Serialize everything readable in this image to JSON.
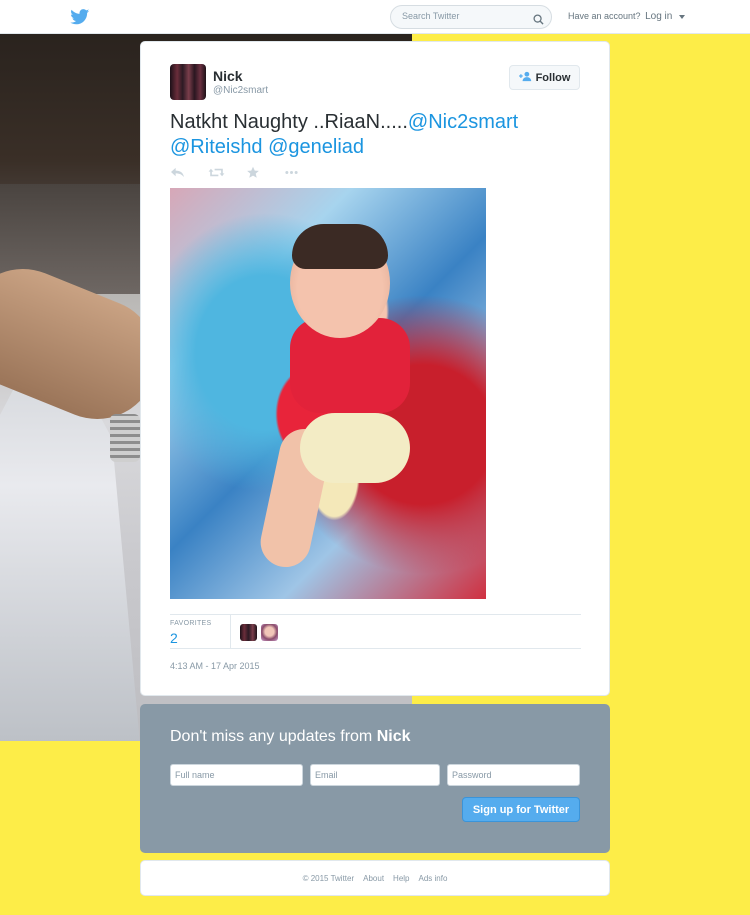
{
  "topbar": {
    "logo_icon": "twitter-bird-icon",
    "search_placeholder": "Search Twitter",
    "account_prompt": "Have an account?",
    "login_label": "Log in"
  },
  "tweet": {
    "author_name": "Nick",
    "author_handle": "@Nic2smart",
    "follow_label": "Follow",
    "text": "Natkht Naughty ..RiaaN.....",
    "mentions": [
      "@Nic2smart",
      "@Riteishd",
      "@geneliad"
    ],
    "actions": [
      "reply-icon",
      "retweet-icon",
      "favorite-icon",
      "more-icon"
    ],
    "favorites_label": "FAVORITES",
    "favorites_count": "2",
    "timestamp": "4:13 AM - 17 Apr 2015"
  },
  "signup": {
    "title_prefix": "Don't miss any updates from",
    "title_name": "Nick",
    "fullname_placeholder": "Full name",
    "email_placeholder": "Email",
    "password_placeholder": "Password",
    "button_label": "Sign up for Twitter"
  },
  "footer": {
    "links": [
      "© 2015 Twitter",
      "About",
      "Help",
      "Ads info"
    ]
  },
  "colors": {
    "background": "#fded48",
    "link_blue": "#1b95e0",
    "signup_panel": "#8899a6",
    "signup_button": "#55acee",
    "twitter_blue": "#55acee"
  }
}
